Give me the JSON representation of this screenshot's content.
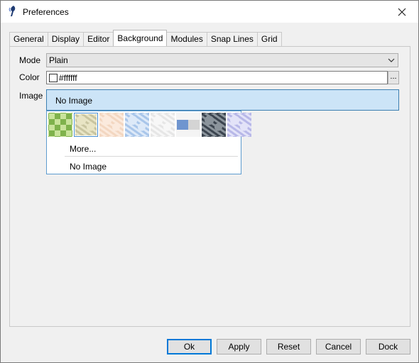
{
  "window": {
    "title": "Preferences",
    "app_icon": "brush-icon",
    "close_icon": "close-icon"
  },
  "tabs": [
    {
      "label": "General"
    },
    {
      "label": "Display"
    },
    {
      "label": "Editor"
    },
    {
      "label": "Background",
      "active": true
    },
    {
      "label": "Modules"
    },
    {
      "label": "Snap Lines"
    },
    {
      "label": "Grid"
    }
  ],
  "background": {
    "mode_label": "Mode",
    "mode_value": "Plain",
    "color_label": "Color",
    "color_value": "#ffffff",
    "color_button": "...",
    "image_label": "Image",
    "image_value": "No Image",
    "dropdown": {
      "thumbnails": [
        {
          "name": "green-diamond-pattern",
          "colors": [
            "#7fb24c",
            "#c9e39b"
          ]
        },
        {
          "name": "cream-granite-texture",
          "colors": [
            "#c9c5a0",
            "#e8e4c4"
          ],
          "selected": true
        },
        {
          "name": "peach-paper-texture",
          "colors": [
            "#f3d7c1",
            "#fbeadd"
          ]
        },
        {
          "name": "blue-crinkle-texture",
          "colors": [
            "#a9c6ea",
            "#dde9f8"
          ]
        },
        {
          "name": "white-marble-texture",
          "colors": [
            "#e6e6e6",
            "#f7f7f7"
          ]
        },
        {
          "name": "blue-gray-blocks",
          "colors": [
            "#6f95cf",
            "#d4d4d4"
          ]
        },
        {
          "name": "dark-marble-texture",
          "colors": [
            "#3c4550",
            "#8b949c"
          ]
        },
        {
          "name": "lavender-crinkle-texture",
          "colors": [
            "#b8b8e8",
            "#e3e3f8"
          ]
        }
      ],
      "more_label": "More...",
      "no_image_label": "No Image"
    }
  },
  "buttons": {
    "ok": "Ok",
    "apply": "Apply",
    "reset": "Reset",
    "cancel": "Cancel",
    "dock": "Dock"
  }
}
